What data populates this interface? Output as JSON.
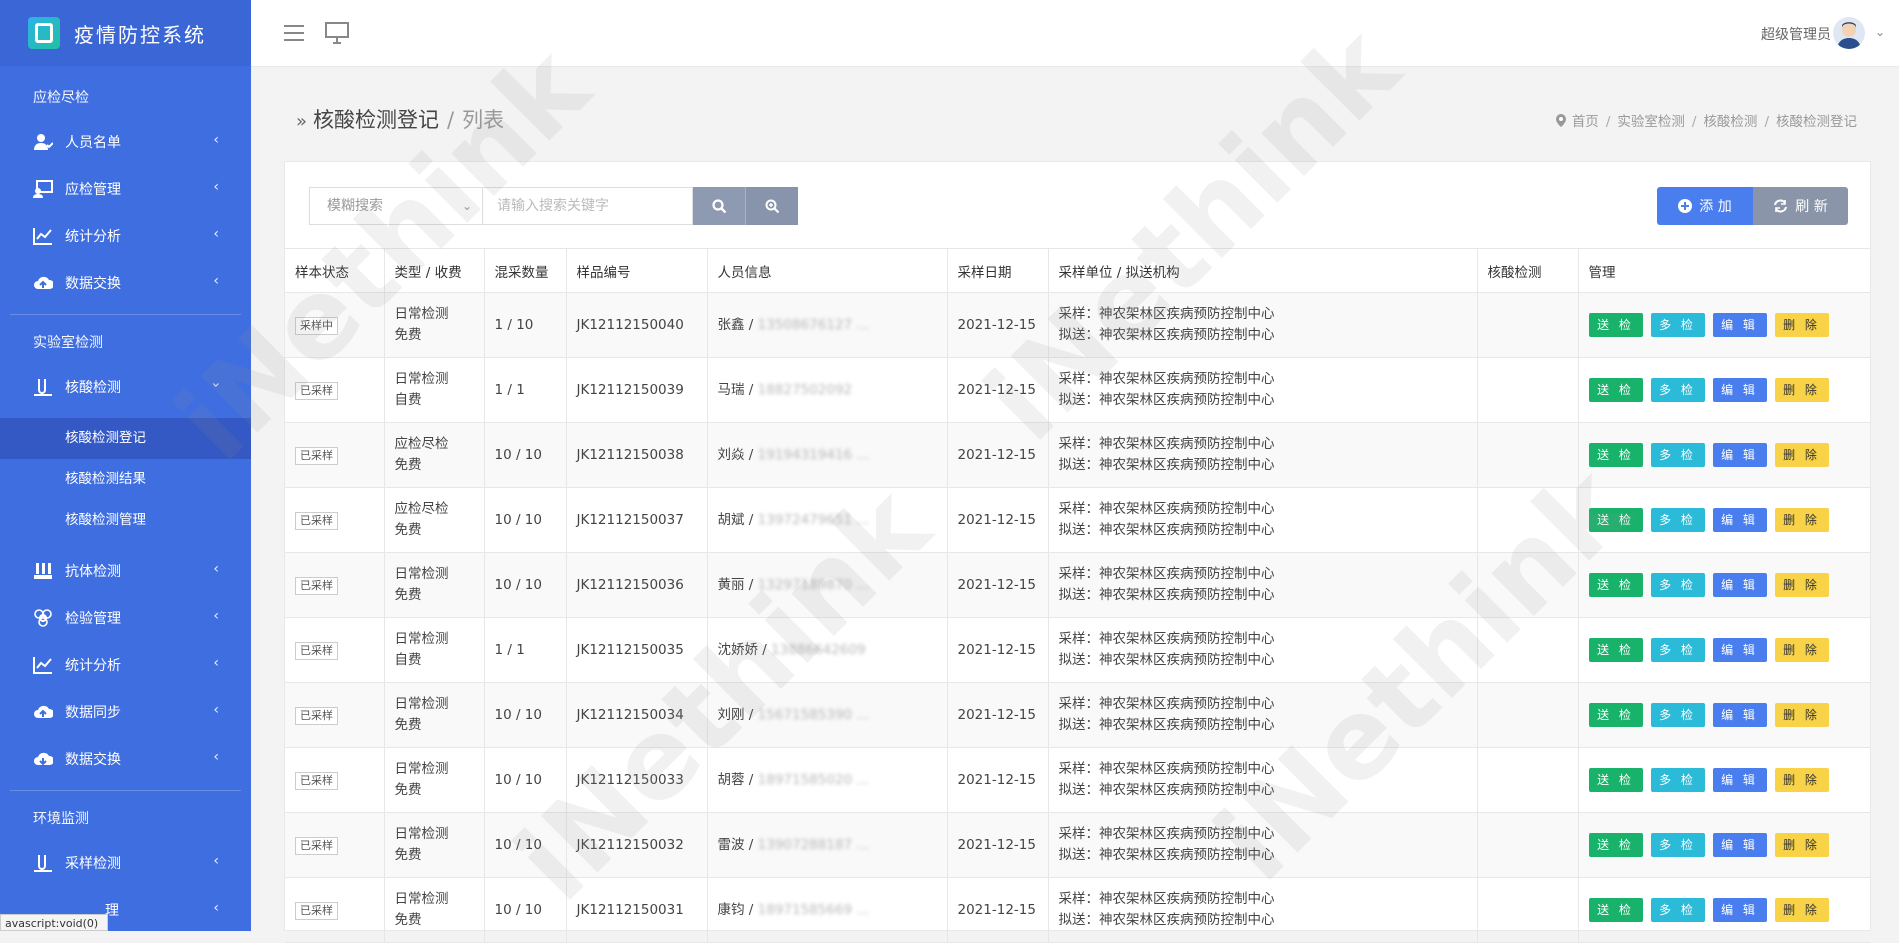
{
  "app": {
    "title": "疫情防控系统"
  },
  "sidebar": {
    "sections": [
      {
        "title": "应检尽检",
        "items": [
          {
            "label": "人员名单",
            "icon": "user-icon"
          },
          {
            "label": "应检管理",
            "icon": "monitor-user-icon"
          },
          {
            "label": "统计分析",
            "icon": "chart-icon"
          },
          {
            "label": "数据交换",
            "icon": "cloud-upload-icon"
          }
        ]
      },
      {
        "title": "实验室检测",
        "items": [
          {
            "label": "核酸检测",
            "icon": "test-tube-icon",
            "expanded": true,
            "children": [
              "核酸检测登记",
              "核酸检测结果",
              "核酸检测管理"
            ]
          },
          {
            "label": "抗体检测",
            "icon": "test-rack-icon"
          },
          {
            "label": "检验管理",
            "icon": "biohazard-icon"
          },
          {
            "label": "统计分析",
            "icon": "chart-icon"
          },
          {
            "label": "数据同步",
            "icon": "cloud-upload-icon"
          },
          {
            "label": "数据交换",
            "icon": "cloud-download-icon"
          }
        ]
      },
      {
        "title": "环境监测",
        "items": [
          {
            "label": "采样检测",
            "icon": "test-tube-icon"
          }
        ]
      }
    ],
    "active_sub": "核酸检测登记",
    "truncated_item": "理"
  },
  "statusbar": {
    "text": "avascript:void(0)"
  },
  "topbar": {
    "user": "超级管理员"
  },
  "page": {
    "title": "核酸检测登记",
    "subtitle": "列表"
  },
  "breadcrumb": [
    "首页",
    "实验室检测",
    "核酸检测",
    "核酸检测登记"
  ],
  "search": {
    "mode": "模糊搜索",
    "placeholder": "请输入搜索关键字"
  },
  "buttons": {
    "add": "添 加",
    "refresh": "刷 新"
  },
  "table": {
    "headers": [
      "样本状态",
      "类型 / 收费",
      "混采数量",
      "样品编号",
      "人员信息",
      "采样日期",
      "采样单位 / 拟送机构",
      "核酸检测",
      "管理"
    ],
    "ops": [
      "送 检",
      "多 检",
      "编 辑",
      "删 除"
    ],
    "rows": [
      {
        "status": "采样中",
        "type": "日常检测",
        "fee": "免费",
        "mix": "1 / 10",
        "sample_no": "JK12112150040",
        "name": "张鑫 / ",
        "phone": "13508676127 ...",
        "date": "2021-12-15",
        "unit": "采样：神农架林区疾病预防控制中心",
        "dest": "拟送：神农架林区疾病预防控制中心",
        "result": ""
      },
      {
        "status": "已采样",
        "type": "日常检测",
        "fee": "自费",
        "mix": "1 / 1",
        "sample_no": "JK12112150039",
        "name": "马瑞 / ",
        "phone": "18827502092",
        "date": "2021-12-15",
        "unit": "采样：神农架林区疾病预防控制中心",
        "dest": "拟送：神农架林区疾病预防控制中心",
        "result": ""
      },
      {
        "status": "已采样",
        "type": "应检尽检",
        "fee": "免费",
        "mix": "10 / 10",
        "sample_no": "JK12112150038",
        "name": "刘焱 / ",
        "phone": "19194319416 ...",
        "date": "2021-12-15",
        "unit": "采样：神农架林区疾病预防控制中心",
        "dest": "拟送：神农架林区疾病预防控制中心",
        "result": ""
      },
      {
        "status": "已采样",
        "type": "应检尽检",
        "fee": "免费",
        "mix": "10 / 10",
        "sample_no": "JK12112150037",
        "name": "胡斌 / ",
        "phone": "13972479651 ...",
        "date": "2021-12-15",
        "unit": "采样：神农架林区疾病预防控制中心",
        "dest": "拟送：神农架林区疾病预防控制中心",
        "result": ""
      },
      {
        "status": "已采样",
        "type": "日常检测",
        "fee": "免费",
        "mix": "10 / 10",
        "sample_no": "JK12112150036",
        "name": "黄丽 / ",
        "phone": "13297189870 ...",
        "date": "2021-12-15",
        "unit": "采样：神农架林区疾病预防控制中心",
        "dest": "拟送：神农架林区疾病预防控制中心",
        "result": ""
      },
      {
        "status": "已采样",
        "type": "日常检测",
        "fee": "自费",
        "mix": "1 / 1",
        "sample_no": "JK12112150035",
        "name": "沈娇娇 / ",
        "phone": "13886642609",
        "date": "2021-12-15",
        "unit": "采样：神农架林区疾病预防控制中心",
        "dest": "拟送：神农架林区疾病预防控制中心",
        "result": ""
      },
      {
        "status": "已采样",
        "type": "日常检测",
        "fee": "免费",
        "mix": "10 / 10",
        "sample_no": "JK12112150034",
        "name": "刘刚 / ",
        "phone": "15671585390 ...",
        "date": "2021-12-15",
        "unit": "采样：神农架林区疾病预防控制中心",
        "dest": "拟送：神农架林区疾病预防控制中心",
        "result": ""
      },
      {
        "status": "已采样",
        "type": "日常检测",
        "fee": "免费",
        "mix": "10 / 10",
        "sample_no": "JK12112150033",
        "name": "胡蓉 / ",
        "phone": "18971585020 ...",
        "date": "2021-12-15",
        "unit": "采样：神农架林区疾病预防控制中心",
        "dest": "拟送：神农架林区疾病预防控制中心",
        "result": ""
      },
      {
        "status": "已采样",
        "type": "日常检测",
        "fee": "免费",
        "mix": "10 / 10",
        "sample_no": "JK12112150032",
        "name": "雷波 / ",
        "phone": "13907288187 ...",
        "date": "2021-12-15",
        "unit": "采样：神农架林区疾病预防控制中心",
        "dest": "拟送：神农架林区疾病预防控制中心",
        "result": ""
      },
      {
        "status": "已采样",
        "type": "日常检测",
        "fee": "免费",
        "mix": "10 / 10",
        "sample_no": "JK12112150031",
        "name": "康钧 / ",
        "phone": "18971585669 ...",
        "date": "2021-12-15",
        "unit": "采样：神农架林区疾病预防控制中心",
        "dest": "拟送：神农架林区疾病预防控制中心",
        "result": ""
      }
    ]
  },
  "watermark": "iNethink"
}
